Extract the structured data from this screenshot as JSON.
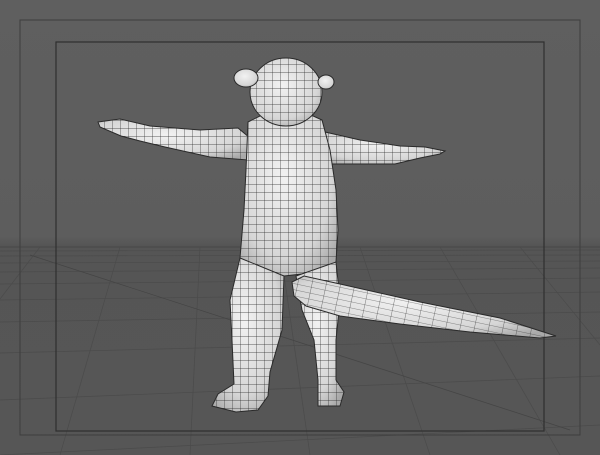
{
  "viewport": {
    "title": "",
    "background": "#5e5e5e",
    "frame_color": "#3a3a3a",
    "grid_color": "#4a4a4a",
    "mesh_fill": "#e4e4e4",
    "mesh_line": "#2a2a2a"
  },
  "model": {
    "description_icon": "character-mesh-icon",
    "pose": "T-pose",
    "view": "back-perspective"
  }
}
